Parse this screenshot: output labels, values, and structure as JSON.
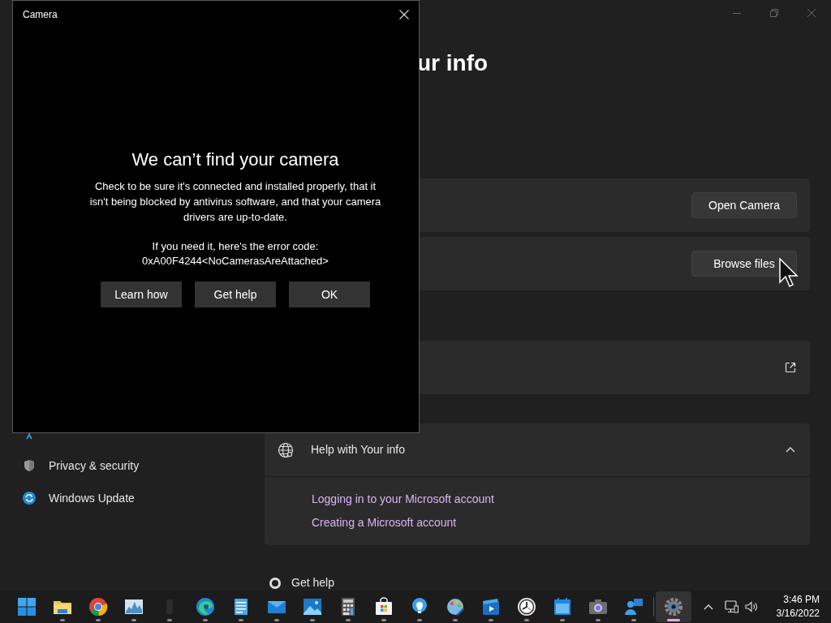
{
  "settings": {
    "heading": "ur info",
    "cards": [
      {
        "kind": "button",
        "button": "Open Camera"
      },
      {
        "kind": "button",
        "button": "Browse files"
      },
      {
        "kind": "external"
      }
    ],
    "help": {
      "title": "Help with Your info",
      "expanded": true,
      "links": [
        "Logging in to your Microsoft account",
        "Creating a Microsoft account"
      ]
    },
    "get_help": "Get help",
    "sidebar": [
      {
        "kind": "accessibility"
      },
      {
        "kind": "shield",
        "label": "Privacy & security"
      },
      {
        "kind": "update",
        "label": "Windows Update"
      }
    ]
  },
  "dialog": {
    "title": "Camera",
    "heading": "We can’t find your camera",
    "body": "Check to be sure it's connected and installed properly, that it isn't being blocked by antivirus software, and that your camera drivers are up-to-date.",
    "code_label": "If you need it, here's the error code:",
    "code": "0xA00F4244<NoCamerasAreAttached>",
    "buttons": [
      "Learn how",
      "Get help",
      "OK"
    ]
  },
  "taskbar": {
    "apps": [
      {
        "kind": "start",
        "selected": false,
        "running": false
      },
      {
        "kind": "folder",
        "selected": false,
        "running": true
      },
      {
        "kind": "chrome",
        "selected": false,
        "running": true
      },
      {
        "kind": "monitor",
        "selected": false,
        "running": true
      },
      {
        "kind": "blank",
        "selected": false,
        "running": true
      },
      {
        "kind": "edge",
        "selected": false,
        "running": true
      },
      {
        "kind": "notepad",
        "selected": false,
        "running": true
      },
      {
        "kind": "mail",
        "selected": false,
        "running": true
      },
      {
        "kind": "photos",
        "selected": false,
        "running": true
      },
      {
        "kind": "calculator",
        "selected": false,
        "running": true
      },
      {
        "kind": "store",
        "selected": false,
        "running": true
      },
      {
        "kind": "bulb",
        "selected": false,
        "running": true
      },
      {
        "kind": "paint",
        "selected": false,
        "running": true
      },
      {
        "kind": "video",
        "selected": false,
        "running": true
      },
      {
        "kind": "clock",
        "selected": false,
        "running": true
      },
      {
        "kind": "calendar",
        "selected": false,
        "running": true
      },
      {
        "kind": "camera",
        "selected": false,
        "running": true
      },
      {
        "kind": "people",
        "selected": false,
        "running": true
      },
      {
        "kind": "settings",
        "selected": true,
        "running": true
      }
    ],
    "time": "3:46 PM",
    "date": "3/16/2022"
  }
}
